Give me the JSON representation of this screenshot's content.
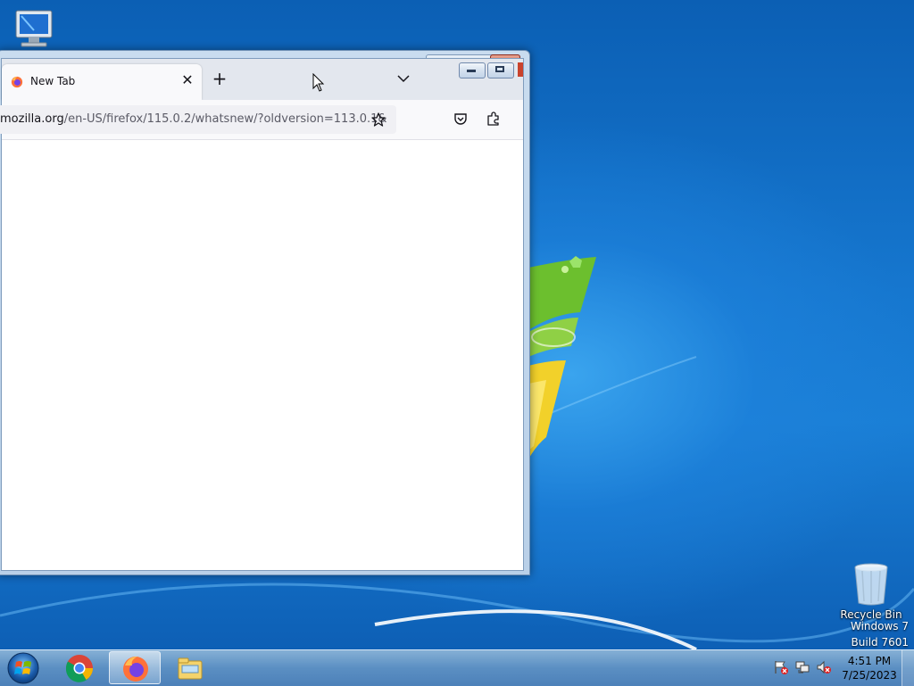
{
  "desktop": {
    "icons": [
      {
        "name": "computer",
        "label": ""
      },
      {
        "name": "recycle-bin",
        "label": "Recycle Bin"
      }
    ],
    "watermark": {
      "line1": "Windows 7",
      "line2": "Build 7601"
    }
  },
  "browser": {
    "tab": {
      "title": "New Tab",
      "favicon": "firefox-icon"
    },
    "url": {
      "host": "mozilla.org",
      "path": "/en-US/firefox/115.0.2/whatsnew/?oldversion=113.0.1&"
    },
    "toolbar_icons": [
      "bookmark-star-icon",
      "pocket-icon",
      "extensions-icon"
    ]
  },
  "taskbar": {
    "pinned": [
      "chrome-icon",
      "firefox-icon",
      "explorer-icon"
    ],
    "tray": [
      "action-center-icon",
      "network-icon",
      "volume-muted-icon"
    ],
    "clock": {
      "time": "4:51 PM",
      "date": "7/25/2023"
    }
  },
  "colors": {
    "accent": "#0a64b8",
    "taskbar": "#5f91c3",
    "window_frame": "#b9d0e8"
  }
}
